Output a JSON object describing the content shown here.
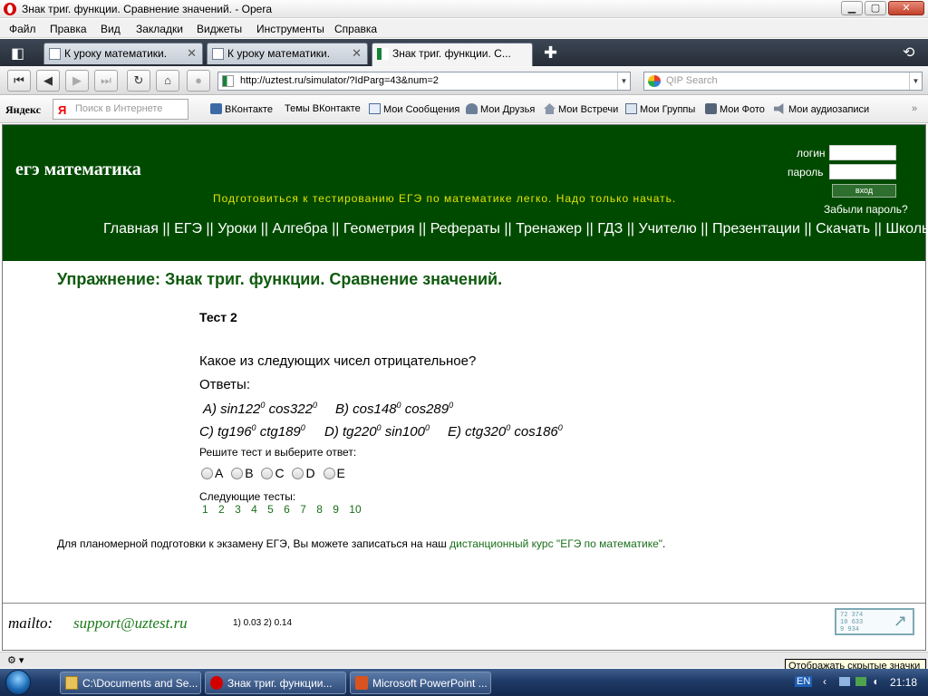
{
  "window": {
    "title": "Знак триг. функции. Сравнение значений. - Opera",
    "min_glyph": "▁",
    "max_glyph": "▢",
    "close_glyph": "✕"
  },
  "menu": [
    "Файл",
    "Правка",
    "Вид",
    "Закладки",
    "Виджеты",
    "Инструменты",
    "Справка"
  ],
  "tabs": [
    {
      "label": "К уроку математики.",
      "active": false
    },
    {
      "label": "К уроку математики.",
      "active": false
    },
    {
      "label": "Знак триг. функции. С...",
      "active": true
    }
  ],
  "nav": {
    "url": "http://uztest.ru/simulator/?IdParg=43&num=2",
    "search_placeholder": "QIP Search"
  },
  "bookmarks": {
    "yandex_logo": "Яндекс",
    "search_placeholder": "Поиск в Интернете",
    "ya_glyph": "Я",
    "items": [
      "ВКонтакте",
      "Темы ВКонтакте",
      "Мои Сообщения",
      "Мои Друзья",
      "Мои Встречи",
      "Мои Группы",
      "Мои Фото",
      "Мои аудиозаписи"
    ]
  },
  "site": {
    "title": "егэ математика",
    "tagline": "Подготовиться к тестированию ЕГЭ по математике легко. Надо только начать.",
    "login_label": "логин",
    "password_label": "пароль",
    "login_button": "вход",
    "forgot": "Забыли пароль?",
    "nav": "Главная || ЕГЭ || Уроки || Алгебра || Геометрия || Рефераты || Тренажер || ГДЗ || Учителю || Презентации || Скачать || Школы ||"
  },
  "exercise": {
    "title": "Упражнение: Знак триг. функции. Сравнение значений.",
    "test_name": "Тест 2",
    "question": "Какое из следующих чисел отрицательное?",
    "answers_label": "Ответы:",
    "options": [
      {
        "letter": "A)",
        "a": "sin122",
        "b": "cos322"
      },
      {
        "letter": "B)",
        "a": "cos148",
        "b": "cos289"
      },
      {
        "letter": "C)",
        "a": "tg196",
        "b": "ctg189"
      },
      {
        "letter": "D)",
        "a": "tg220",
        "b": "sin100"
      },
      {
        "letter": "E)",
        "a": "ctg320",
        "b": "cos186"
      }
    ],
    "degree": "0",
    "solve_label": "Решите тест и выберите ответ:",
    "choices": [
      "A",
      "B",
      "C",
      "D",
      "E"
    ],
    "next_label": "Следующие тесты:",
    "next_tests": [
      "1",
      "2",
      "3",
      "4",
      "5",
      "6",
      "7",
      "8",
      "9",
      "10"
    ],
    "promo_text": "Для планомерной подготовки к экзамену ЕГЭ, Вы можете записаться на наш ",
    "promo_link": "дистанционный курс \"ЕГЭ по математике\"",
    "promo_end": "."
  },
  "footer": {
    "mailto": "mailto:",
    "email": "support@uztest.ru",
    "timing": "1) 0.03   2) 0.14",
    "counter_lines": [
      "72 374",
      "10 633",
      "9 934"
    ],
    "counter_arrow": "↗"
  },
  "status": {
    "tooltip": "Отображать скрытые значки"
  },
  "taskbar": {
    "tasks": [
      "C:\\Documents and Se...",
      "Знак триг. функции...",
      "Microsoft PowerPoint ..."
    ],
    "lang": "EN",
    "clock": "21:18"
  }
}
